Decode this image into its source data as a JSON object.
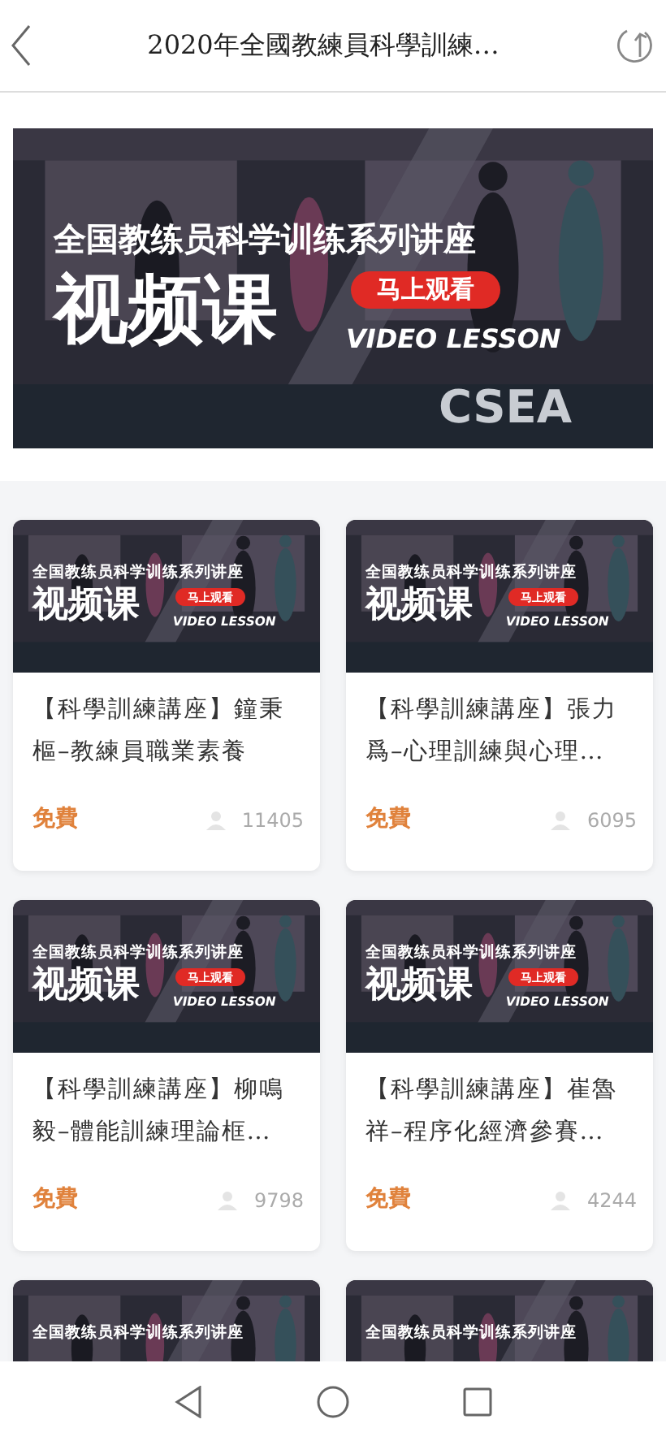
{
  "header": {
    "title": "2020年全國教練員科學訓練…"
  },
  "banner": {
    "heading": "全国教练员科学训练系列讲座",
    "title": "视频课",
    "cta": "马上观看",
    "subtitle": "VIDEO LESSON",
    "logo": "CSEA"
  },
  "courses": [
    {
      "thumb": {
        "heading": "全国教练员科学训练系列讲座",
        "title": "视频课",
        "cta": "马上观看",
        "subtitle": "VIDEO LESSON"
      },
      "title": "【科學訓練講座】鐘秉樞–教練員職業素養",
      "price": "免費",
      "views": "11405"
    },
    {
      "thumb": {
        "heading": "全国教练员科学训练系列讲座",
        "title": "视频课",
        "cta": "马上观看",
        "subtitle": "VIDEO LESSON"
      },
      "title": "【科學訓練講座】張力爲–心理訓練與心理…",
      "price": "免費",
      "views": "6095"
    },
    {
      "thumb": {
        "heading": "全国教练员科学训练系列讲座",
        "title": "视频课",
        "cta": "马上观看",
        "subtitle": "VIDEO LESSON"
      },
      "title": "【科學訓練講座】柳鳴毅–體能訓練理論框…",
      "price": "免費",
      "views": "9798"
    },
    {
      "thumb": {
        "heading": "全国教练员科学训练系列讲座",
        "title": "视频课",
        "cta": "马上观看",
        "subtitle": "VIDEO LESSON"
      },
      "title": "【科學訓練講座】崔魯祥–程序化經濟參賽…",
      "price": "免費",
      "views": "4244"
    },
    {
      "thumb": {
        "heading": "全国教练员科学训练系列讲座"
      }
    },
    {
      "thumb": {
        "heading": "全国教练员科学训练系列讲座"
      }
    }
  ]
}
